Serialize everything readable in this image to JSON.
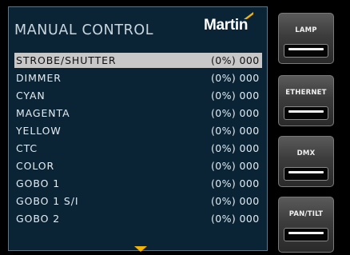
{
  "screen": {
    "title": "MANUAL CONTROL",
    "brand": "Martin",
    "rows": [
      {
        "name": "STROBE/SHUTTER",
        "value": "(0%) 000",
        "selected": true
      },
      {
        "name": "DIMMER",
        "value": "(0%) 000"
      },
      {
        "name": "CYAN",
        "value": "(0%) 000"
      },
      {
        "name": "MAGENTA",
        "value": "(0%) 000"
      },
      {
        "name": "YELLOW",
        "value": "(0%) 000"
      },
      {
        "name": "CTC",
        "value": "(0%) 000"
      },
      {
        "name": "COLOR",
        "value": "(0%) 000"
      },
      {
        "name": "GOBO 1",
        "value": "(0%) 000"
      },
      {
        "name": "GOBO 1 S/I",
        "value": "(0%) 000"
      },
      {
        "name": "GOBO 2",
        "value": "(0%) 000"
      }
    ],
    "scroll_indicator_icon": "triangle-down-icon",
    "colors": {
      "background": "#0a2436",
      "selection": "#c8c8c8",
      "accent": "#f3b300"
    }
  },
  "side_buttons": [
    {
      "label": "LAMP"
    },
    {
      "label": "ETHERNET"
    },
    {
      "label": "DMX"
    },
    {
      "label": "PAN/TILT"
    }
  ]
}
